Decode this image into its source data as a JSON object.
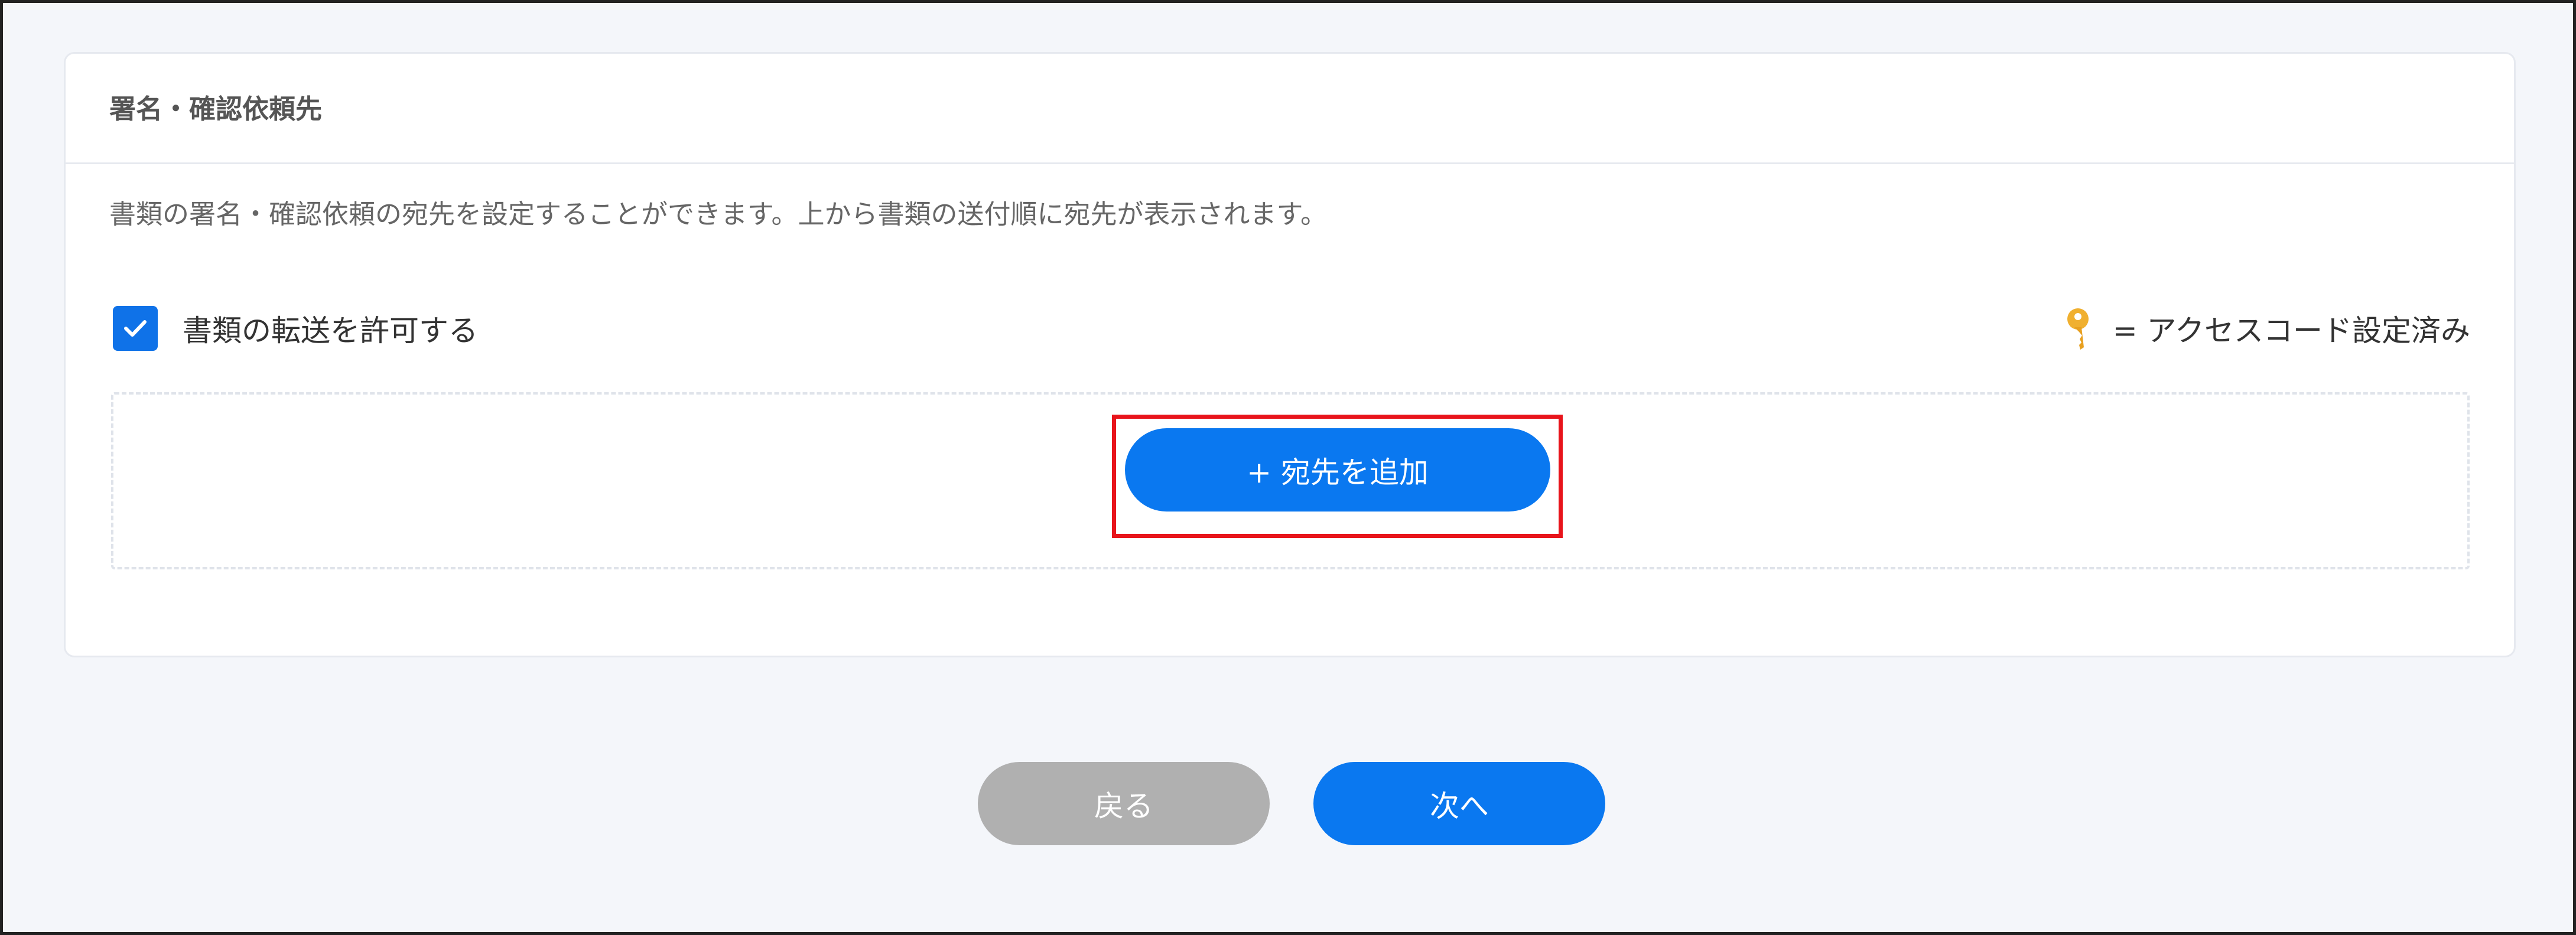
{
  "section": {
    "title": "署名・確認依頼先",
    "description": "書類の署名・確認依頼の宛先を設定することができます。上から書類の送付順に宛先が表示されます。"
  },
  "forwarding": {
    "label": "書類の転送を許可する",
    "checked": true
  },
  "legend": {
    "icon": "key-icon",
    "text": "= アクセスコード設定済み"
  },
  "recipients": {
    "add_button_label": "+ 宛先を追加"
  },
  "footer": {
    "back_label": "戻る",
    "next_label": "次へ"
  },
  "colors": {
    "primary": "#0a78f0",
    "checkbox": "#0f72e8",
    "disabled_button": "#b0b0b0",
    "highlight": "#e8141b",
    "key_icon": "#f0b030",
    "background": "#f4f6fa"
  }
}
